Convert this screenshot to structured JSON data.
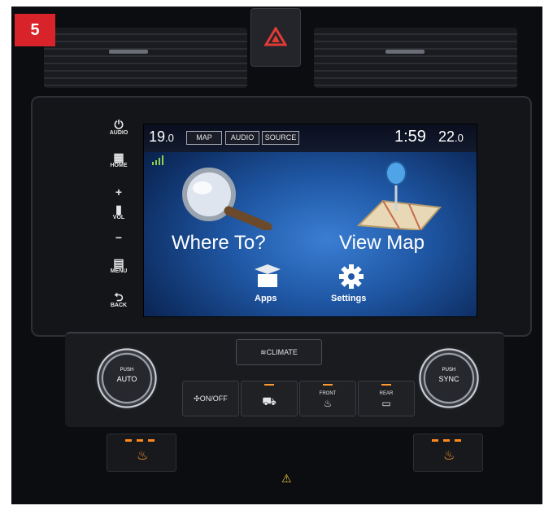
{
  "badge": "5",
  "hard_buttons": {
    "audio": "AUDIO",
    "home": "HOME",
    "vol_plus": "+",
    "vol": "VOL",
    "vol_minus": "−",
    "menu": "MENU",
    "back": "BACK"
  },
  "screen": {
    "temp_left": "19",
    "temp_left_dec": ".0",
    "tabs": [
      "MAP",
      "AUDIO",
      "SOURCE"
    ],
    "clock": "1:59",
    "temp_right": "22",
    "temp_right_dec": ".0",
    "where_to": "Where To?",
    "view_map": "View Map",
    "apps": "Apps",
    "settings": "Settings"
  },
  "climate": {
    "climate_label": "CLIMATE",
    "left_knob_top": "PUSH",
    "left_knob_main": "AUTO",
    "right_knob_top": "PUSH",
    "right_knob_main": "SYNC",
    "ac_top": "ON",
    "ac_bottom": "OFF",
    "front_label": "FRONT",
    "rear_label": "REAR"
  },
  "colors": {
    "badge": "#d8232a",
    "screen_center": "#3a7ed3",
    "screen_edge": "#071636",
    "led": "#ff9a2e"
  },
  "icons": [
    "power-icon",
    "home-grid-icon",
    "menu-icon",
    "back-icon",
    "magnifier-icon",
    "map-pin-icon",
    "apps-box-icon",
    "gear-icon",
    "hazard-icon",
    "signal-icon",
    "seat-heater-icon"
  ]
}
